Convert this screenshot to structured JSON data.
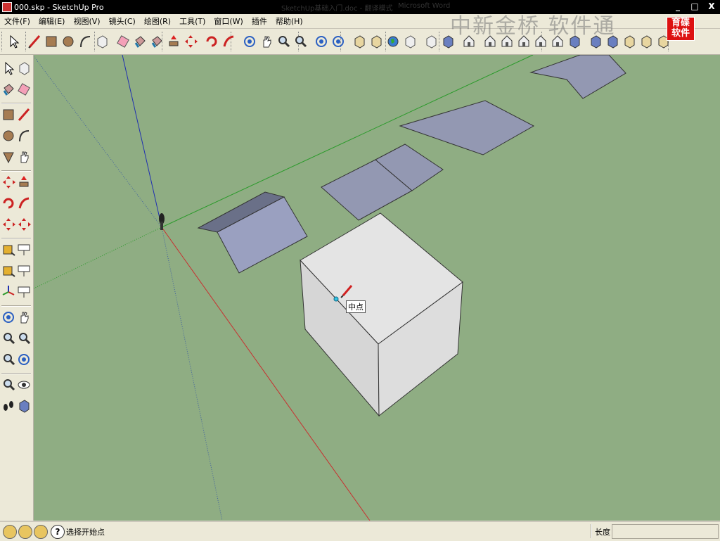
{
  "window": {
    "title": "000.skp - SketchUp Pro",
    "background_tabs": [
      "SketchUp基础入门.doc - 翻译模式",
      "Microsoft Word"
    ],
    "buttons": [
      "_",
      "□",
      "X"
    ]
  },
  "menu": [
    "文件(F)",
    "编辑(E)",
    "视图(V)",
    "镜头(C)",
    "绘图(R)",
    "工具(T)",
    "窗口(W)",
    "插件",
    "帮助(H)"
  ],
  "watermark": {
    "text": "中新金桥 软件通",
    "logo": "育碟软件"
  },
  "toolbar_top": [
    "select-arrow-icon",
    "pencil-icon",
    "rectangle-icon",
    "circle-icon",
    "arc-icon",
    "make-component-icon",
    "eraser-icon",
    "paint-bucket-icon",
    "paint-bucket-alt-icon",
    "push-pull-icon",
    "move-icon",
    "rotate-icon",
    "follow-me-icon",
    "orbit-icon",
    "pan-hand-icon",
    "zoom-icon",
    "zoom-extents-icon",
    "previous-view-icon",
    "next-view-icon",
    "get-models-icon",
    "share-model-icon",
    "earth-icon",
    "component-up-icon",
    "component-down-icon",
    "section-icon",
    "iso-view-icon",
    "top-view-icon",
    "front-view-icon",
    "right-view-icon",
    "back-view-icon",
    "left-view-icon",
    "xray-icon",
    "wireframe-icon",
    "hidden-line-icon",
    "shaded-icon",
    "shaded-textures-icon",
    "monochrome-icon"
  ],
  "toolbar_left": [
    "select-icon",
    "make-component-icon",
    "paint-bucket-icon",
    "eraser-icon",
    "rectangle-icon",
    "line-icon",
    "circle-icon",
    "arc-icon",
    "polygon-icon",
    "freehand-icon",
    "move-icon",
    "push-pull-icon",
    "rotate-icon",
    "follow-me-icon",
    "scale-icon",
    "offset-icon",
    "tape-measure-icon",
    "dimension-icon",
    "protractor-icon",
    "text-icon",
    "axes-icon",
    "3d-text-icon",
    "orbit-icon",
    "pan-icon",
    "zoom-icon",
    "zoom-window-icon",
    "zoom-extents-icon",
    "previous-icon",
    "position-camera-icon",
    "look-around-icon",
    "walk-icon",
    "section-plane-icon"
  ],
  "viewport": {
    "background": "#8fad83",
    "face_color": "#9aa0b8",
    "box_color": "#dcdcdc",
    "axis_colors": {
      "x": "#c83030",
      "y": "#2a9a2a",
      "z": "#2030b0"
    },
    "inference_tooltip": "中点"
  },
  "status": {
    "hint": "选择开始点",
    "length_label": "长度",
    "length_value": ""
  }
}
